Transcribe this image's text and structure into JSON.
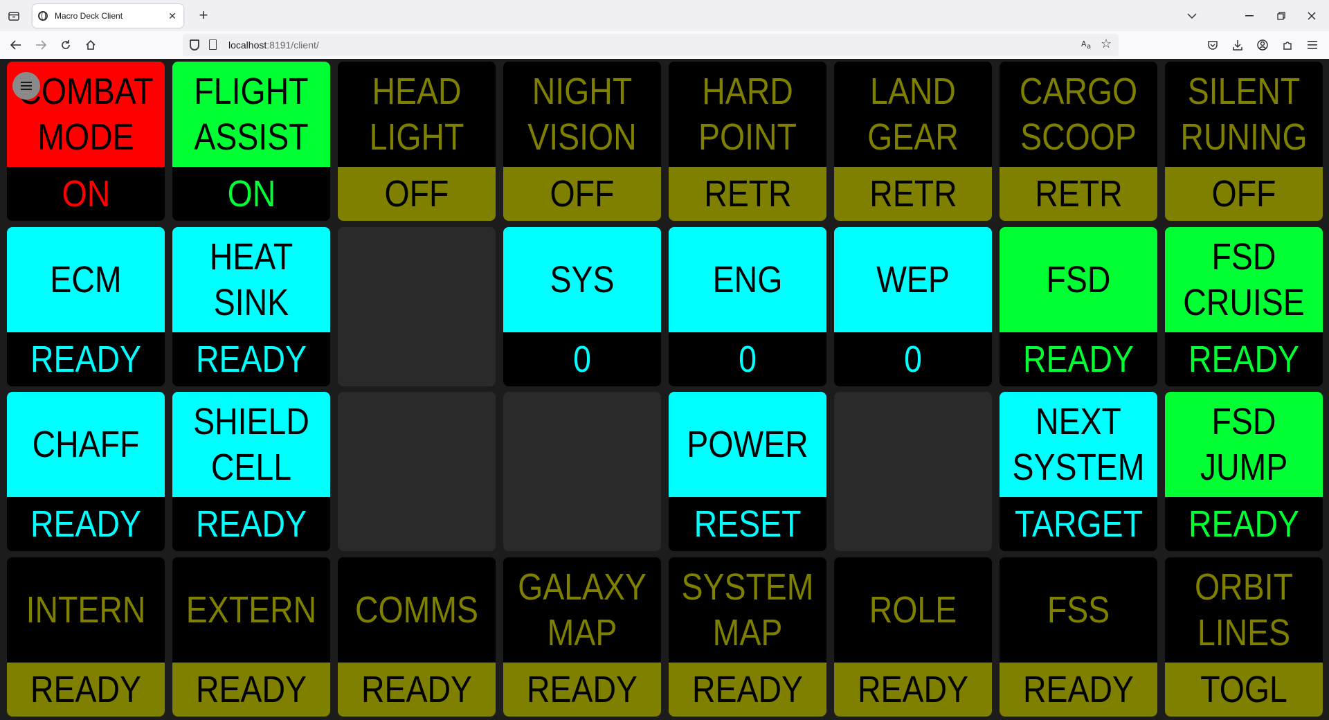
{
  "browser": {
    "tab_title": "Macro Deck Client",
    "url_host": "localhost",
    "url_rest": ":8191/client/",
    "new_tab_label": "+",
    "close_tab_label": "✕"
  },
  "colors": {
    "red": "#ff0000",
    "green": "#00ff33",
    "cyan": "#00ffff",
    "olive": "#7f7f00",
    "black": "#000000",
    "empty": "#2a2a2a"
  },
  "deck": {
    "rows": [
      [
        {
          "label": "COMBAT\nMODE",
          "status": "ON",
          "top_bg": "#ff0000",
          "top_fg": "#000000",
          "bottom_bg": "#000000",
          "bottom_fg": "#ff0000"
        },
        {
          "label": "FLIGHT\nASSIST",
          "status": "ON",
          "top_bg": "#00ff33",
          "top_fg": "#000000",
          "bottom_bg": "#000000",
          "bottom_fg": "#00ff33"
        },
        {
          "label": "HEAD\nLIGHT",
          "status": "OFF",
          "top_bg": "#000000",
          "top_fg": "#7f7f00",
          "bottom_bg": "#7f7f00",
          "bottom_fg": "#000000"
        },
        {
          "label": "NIGHT\nVISION",
          "status": "OFF",
          "top_bg": "#000000",
          "top_fg": "#7f7f00",
          "bottom_bg": "#7f7f00",
          "bottom_fg": "#000000"
        },
        {
          "label": "HARD\nPOINT",
          "status": "RETR",
          "top_bg": "#000000",
          "top_fg": "#7f7f00",
          "bottom_bg": "#7f7f00",
          "bottom_fg": "#000000"
        },
        {
          "label": "LAND\nGEAR",
          "status": "RETR",
          "top_bg": "#000000",
          "top_fg": "#7f7f00",
          "bottom_bg": "#7f7f00",
          "bottom_fg": "#000000"
        },
        {
          "label": "CARGO\nSCOOP",
          "status": "RETR",
          "top_bg": "#000000",
          "top_fg": "#7f7f00",
          "bottom_bg": "#7f7f00",
          "bottom_fg": "#000000"
        },
        {
          "label": "SILENT\nRUNING",
          "status": "OFF",
          "top_bg": "#000000",
          "top_fg": "#7f7f00",
          "bottom_bg": "#7f7f00",
          "bottom_fg": "#000000"
        }
      ],
      [
        {
          "label": "ECM",
          "status": "READY",
          "top_bg": "#00ffff",
          "top_fg": "#000000",
          "bottom_bg": "#000000",
          "bottom_fg": "#00ffff"
        },
        {
          "label": "HEAT\nSINK",
          "status": "READY",
          "top_bg": "#00ffff",
          "top_fg": "#000000",
          "bottom_bg": "#000000",
          "bottom_fg": "#00ffff"
        },
        {
          "empty": true
        },
        {
          "label": "SYS",
          "status": "0",
          "top_bg": "#00ffff",
          "top_fg": "#000000",
          "bottom_bg": "#000000",
          "bottom_fg": "#00ffff"
        },
        {
          "label": "ENG",
          "status": "0",
          "top_bg": "#00ffff",
          "top_fg": "#000000",
          "bottom_bg": "#000000",
          "bottom_fg": "#00ffff"
        },
        {
          "label": "WEP",
          "status": "0",
          "top_bg": "#00ffff",
          "top_fg": "#000000",
          "bottom_bg": "#000000",
          "bottom_fg": "#00ffff"
        },
        {
          "label": "FSD",
          "status": "READY",
          "top_bg": "#00ff33",
          "top_fg": "#000000",
          "bottom_bg": "#000000",
          "bottom_fg": "#00ff33"
        },
        {
          "label": "FSD\nCRUISE",
          "status": "READY",
          "top_bg": "#00ff33",
          "top_fg": "#000000",
          "bottom_bg": "#000000",
          "bottom_fg": "#00ff33"
        }
      ],
      [
        {
          "label": "CHAFF",
          "status": "READY",
          "top_bg": "#00ffff",
          "top_fg": "#000000",
          "bottom_bg": "#000000",
          "bottom_fg": "#00ffff"
        },
        {
          "label": "SHIELD\nCELL",
          "status": "READY",
          "top_bg": "#00ffff",
          "top_fg": "#000000",
          "bottom_bg": "#000000",
          "bottom_fg": "#00ffff"
        },
        {
          "empty": true
        },
        {
          "empty": true
        },
        {
          "label": "POWER",
          "status": "RESET",
          "top_bg": "#00ffff",
          "top_fg": "#000000",
          "bottom_bg": "#000000",
          "bottom_fg": "#00ffff"
        },
        {
          "empty": true
        },
        {
          "label": "NEXT\nSYSTEM",
          "status": "TARGET",
          "top_bg": "#00ffff",
          "top_fg": "#000000",
          "bottom_bg": "#000000",
          "bottom_fg": "#00ffff"
        },
        {
          "label": "FSD\nJUMP",
          "status": "READY",
          "top_bg": "#00ff33",
          "top_fg": "#000000",
          "bottom_bg": "#000000",
          "bottom_fg": "#00ff33"
        }
      ],
      [
        {
          "label": "INTERN",
          "status": "READY",
          "top_bg": "#000000",
          "top_fg": "#7f7f00",
          "bottom_bg": "#7f7f00",
          "bottom_fg": "#000000"
        },
        {
          "label": "EXTERN",
          "status": "READY",
          "top_bg": "#000000",
          "top_fg": "#7f7f00",
          "bottom_bg": "#7f7f00",
          "bottom_fg": "#000000"
        },
        {
          "label": "COMMS",
          "status": "READY",
          "top_bg": "#000000",
          "top_fg": "#7f7f00",
          "bottom_bg": "#7f7f00",
          "bottom_fg": "#000000"
        },
        {
          "label": "GALAXY\nMAP",
          "status": "READY",
          "top_bg": "#000000",
          "top_fg": "#7f7f00",
          "bottom_bg": "#7f7f00",
          "bottom_fg": "#000000"
        },
        {
          "label": "SYSTEM\nMAP",
          "status": "READY",
          "top_bg": "#000000",
          "top_fg": "#7f7f00",
          "bottom_bg": "#7f7f00",
          "bottom_fg": "#000000"
        },
        {
          "label": "ROLE",
          "status": "READY",
          "top_bg": "#000000",
          "top_fg": "#7f7f00",
          "bottom_bg": "#7f7f00",
          "bottom_fg": "#000000"
        },
        {
          "label": "FSS",
          "status": "READY",
          "top_bg": "#000000",
          "top_fg": "#7f7f00",
          "bottom_bg": "#7f7f00",
          "bottom_fg": "#000000"
        },
        {
          "label": "ORBIT\nLINES",
          "status": "TOGL",
          "top_bg": "#000000",
          "top_fg": "#7f7f00",
          "bottom_bg": "#7f7f00",
          "bottom_fg": "#000000"
        }
      ]
    ]
  }
}
